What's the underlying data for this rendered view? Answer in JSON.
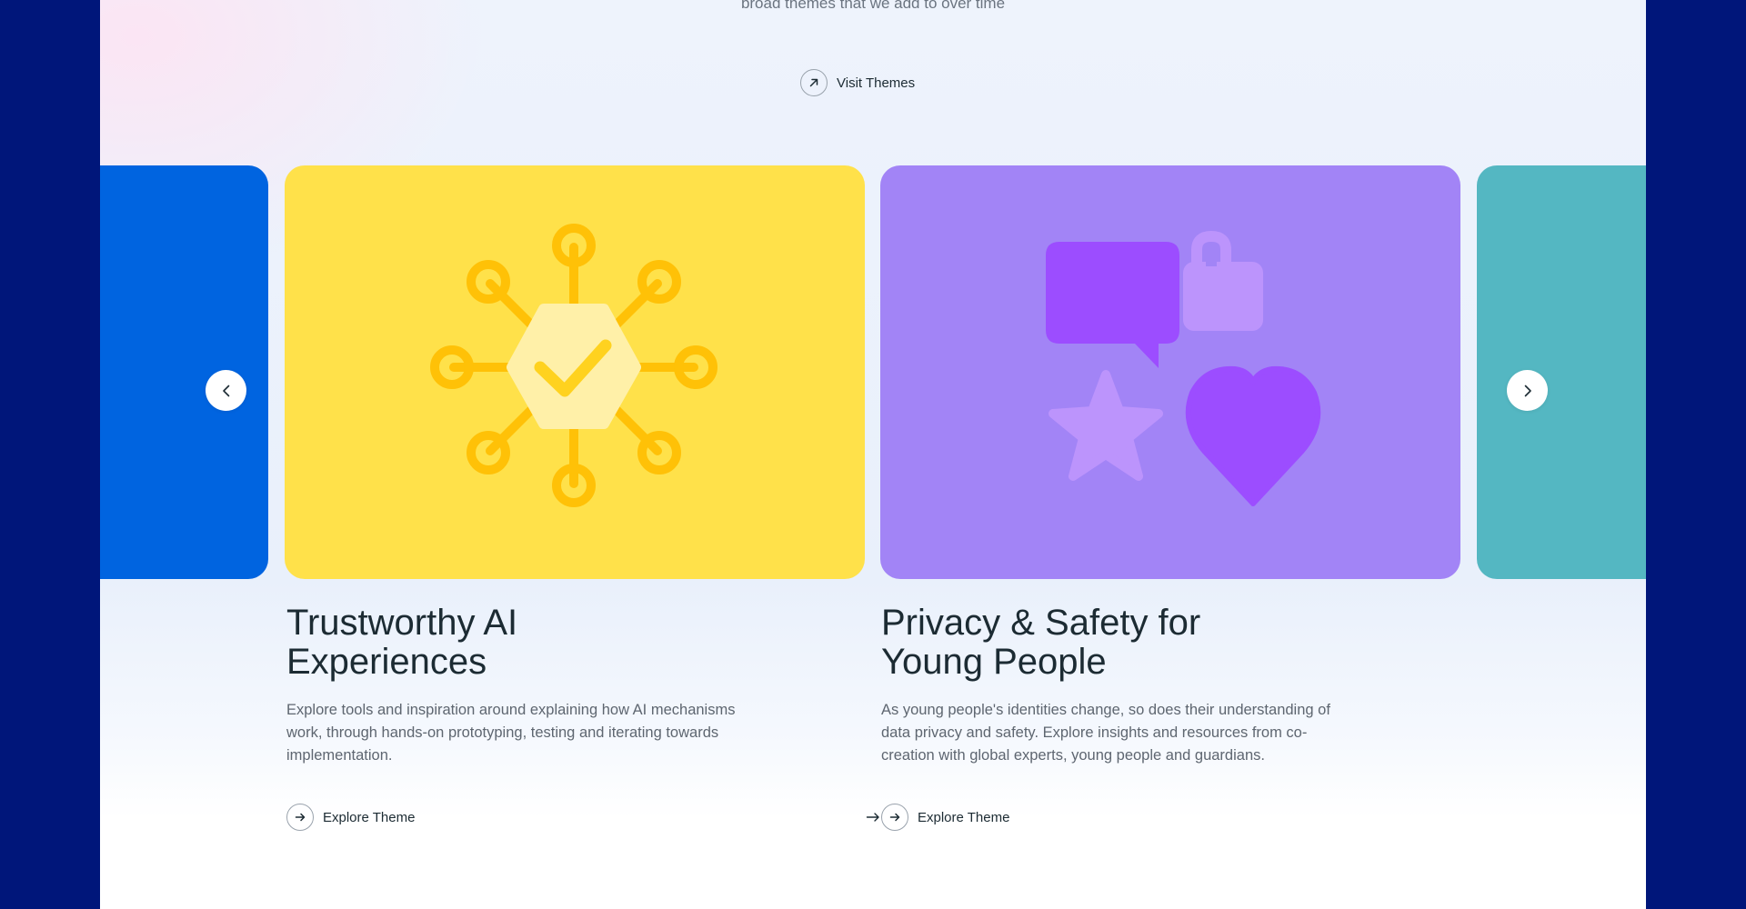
{
  "intro": {
    "text": "broad themes that we add to over time"
  },
  "visit_link": {
    "label": "Visit Themes",
    "icon": "arrow-up-right-icon"
  },
  "carousel": {
    "prev_icon": "chevron-left-icon",
    "next_icon": "chevron-right-icon",
    "cards": [
      {
        "title": "Trustworthy AI Experiences",
        "title_line1": "Trustworthy AI",
        "title_line2": "Experiences",
        "description": "Explore tools and inspiration around explaining how AI mechanisms work, through hands-on prototyping, testing and iterating towards implementation.",
        "cta": "Explore Theme",
        "color": "#ffe14a",
        "illustration": "network-check-icon"
      },
      {
        "title": "Privacy & Safety for Young People",
        "title_line1": "Privacy & Safety for",
        "title_line2": "Young People",
        "description": "As young people's identities change, so does their understanding of data privacy and safety. Explore insights and resources from co-creation with global experts, young people and guardians.",
        "cta": "Explore Theme",
        "color": "#a284f6",
        "illustration": "chat-lock-star-heart-icon"
      }
    ],
    "side_cards": [
      {
        "color": "#0064e0"
      },
      {
        "color": "#54b7c2"
      }
    ]
  },
  "colors": {
    "outer_background": "#00167a",
    "text_dark": "#1c2b33",
    "text_muted": "#5e6670"
  }
}
